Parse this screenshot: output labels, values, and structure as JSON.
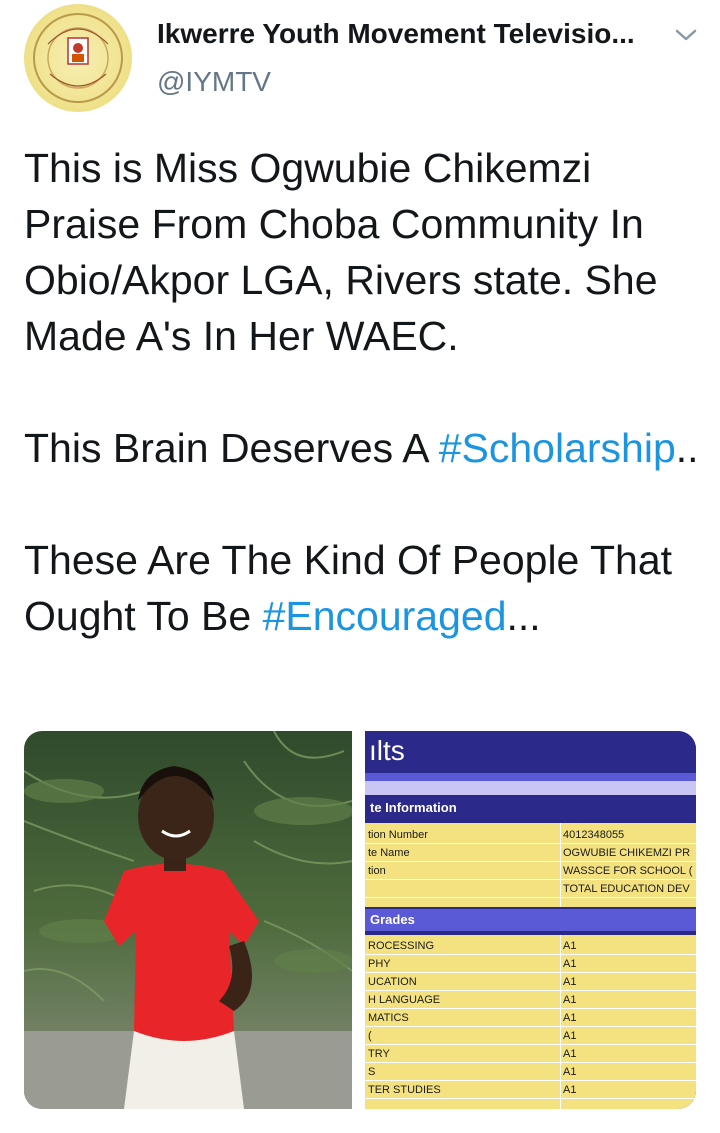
{
  "author": {
    "display_name": "Ikwerre Youth Movement Televisio...",
    "handle": "@IYMTV"
  },
  "tweet": {
    "para1": "This is Miss Ogwubie Chikemzi Praise From Choba Community In Obio/Akpor LGA, Rivers state. She Made A's In Her WAEC.",
    "para2_prefix": "This Brain Deserves A ",
    "hashtag1": "#Scholarship",
    "para2_suffix": "..",
    "para3_prefix": "These Are The Kind Of People That Ought To Be ",
    "hashtag2": "#Encouraged",
    "para3_suffix": "..."
  },
  "result_card": {
    "title": "ılts",
    "candidate_section": "te Information",
    "candidate_rows": [
      {
        "label": "tion Number",
        "value": "4012348055"
      },
      {
        "label": "te Name",
        "value": "OGWUBIE CHIKEMZI PR"
      },
      {
        "label": "tion",
        "value": "WASSCE FOR SCHOOL ("
      },
      {
        "label": "",
        "value": "TOTAL EDUCATION DEV"
      }
    ],
    "grades_section": "Grades",
    "grade_rows": [
      {
        "subject": "ROCESSING",
        "grade": "A1"
      },
      {
        "subject": "PHY",
        "grade": "A1"
      },
      {
        "subject": "UCATION",
        "grade": "A1"
      },
      {
        "subject": "H LANGUAGE",
        "grade": "A1"
      },
      {
        "subject": "MATICS",
        "grade": "A1"
      },
      {
        "subject": "(",
        "grade": "A1"
      },
      {
        "subject": "TRY",
        "grade": "A1"
      },
      {
        "subject": "S",
        "grade": "A1"
      },
      {
        "subject": "TER STUDIES",
        "grade": "A1"
      }
    ]
  },
  "icons": {
    "chevron": "chevron-down-icon",
    "avatar": "organization-logo"
  }
}
